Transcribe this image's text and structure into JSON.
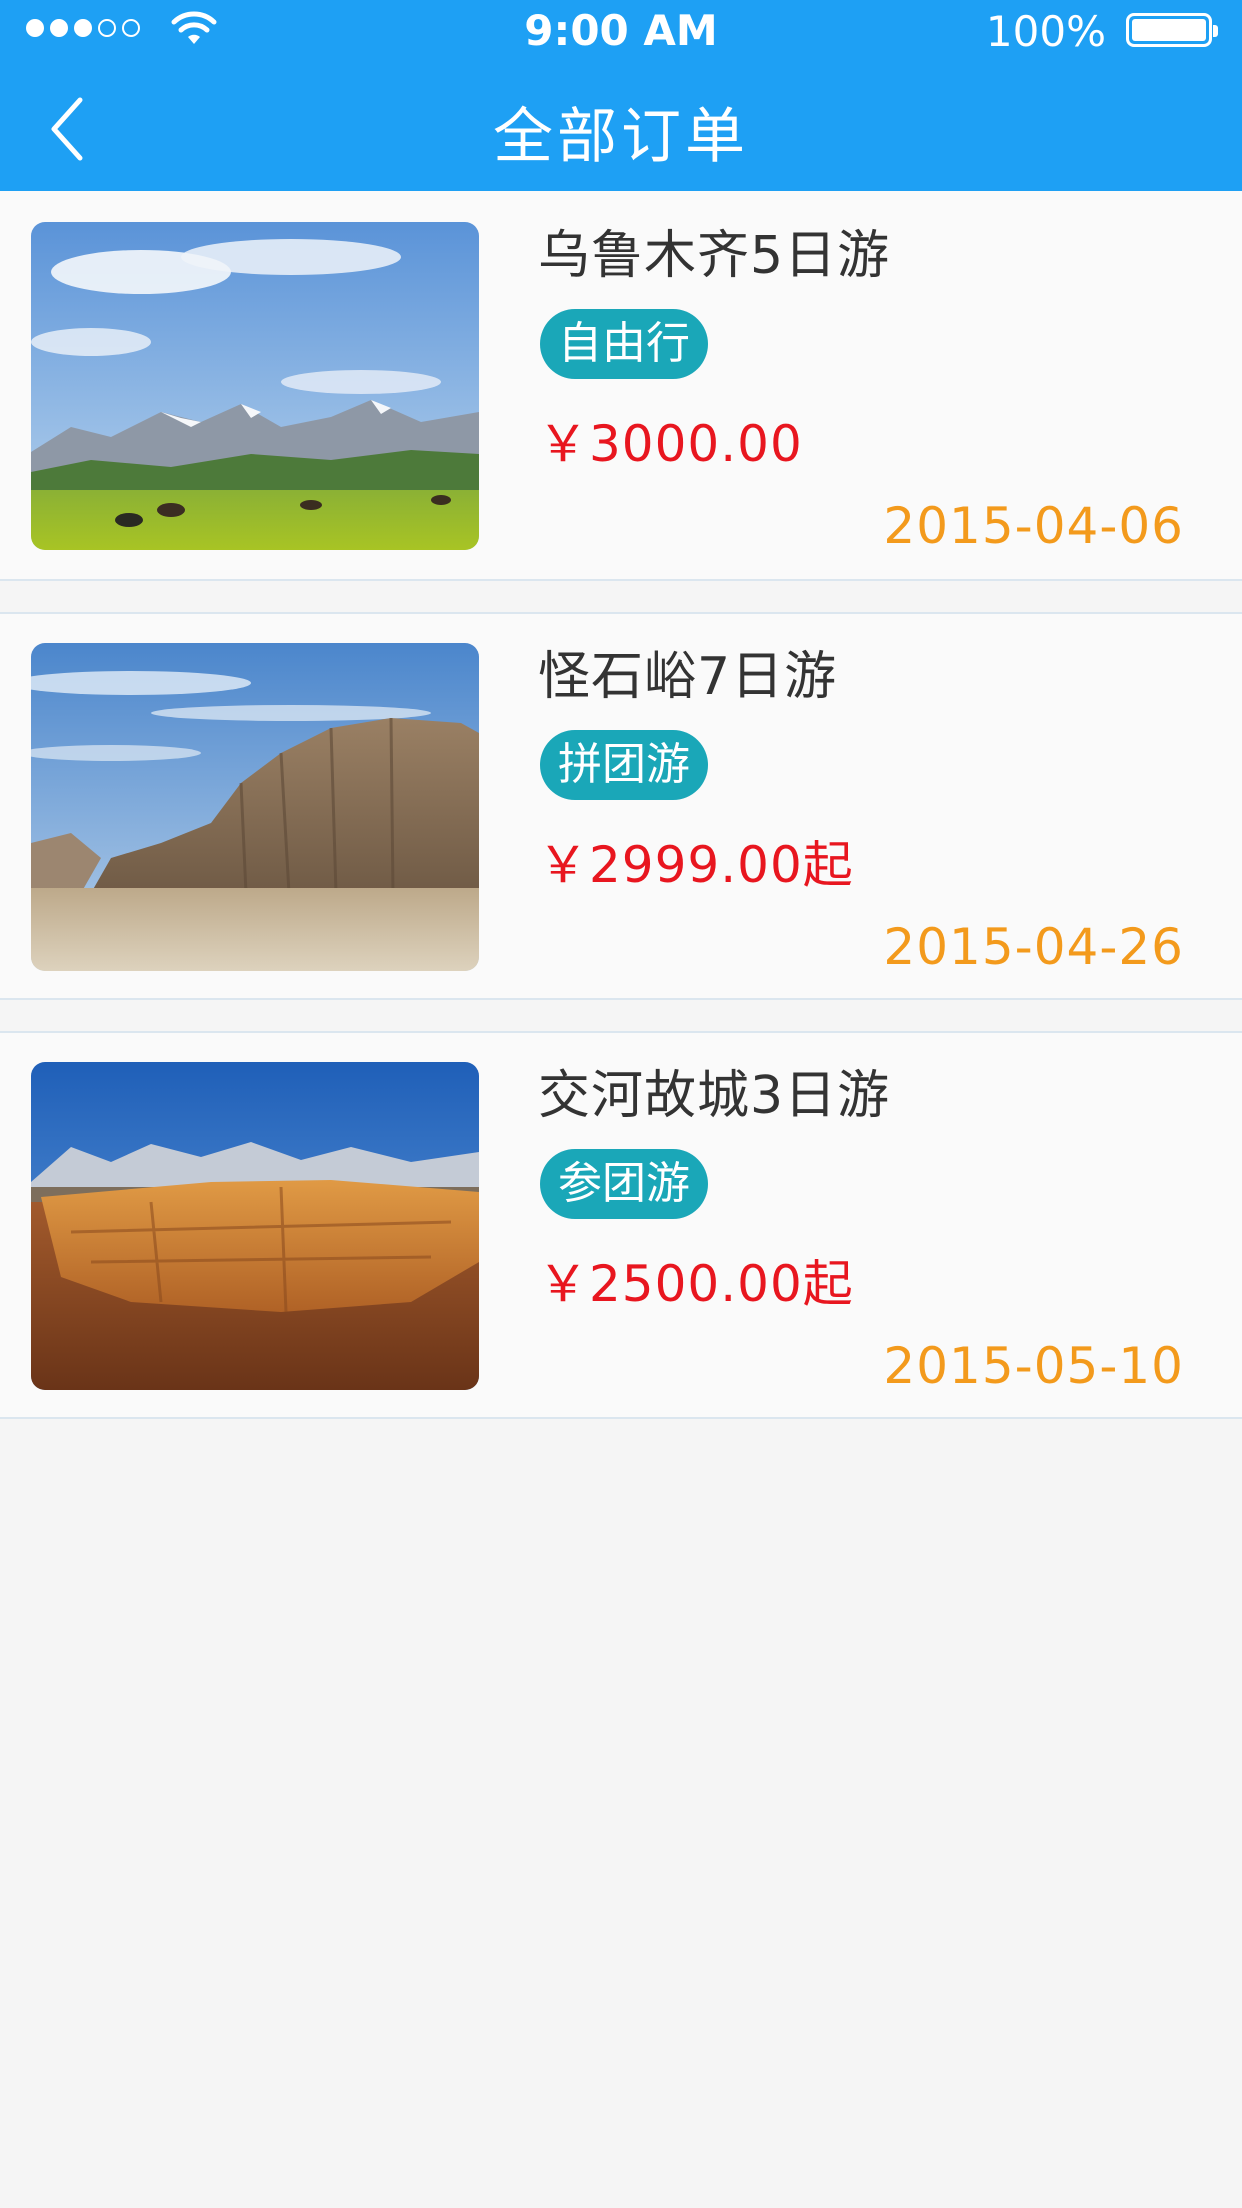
{
  "status_bar": {
    "time": "9:00 AM",
    "battery": "100%",
    "signal_dots_filled": 3,
    "signal_dots_total": 5
  },
  "nav": {
    "title": "全部订单",
    "back_icon": "chevron-left-icon"
  },
  "colors": {
    "header": "#1ea0f4",
    "tag": "#1aa7b8",
    "price": "#e8161f",
    "date": "#f39a1c"
  },
  "orders": [
    {
      "title": "乌鲁木齐5日游",
      "tag": "自由行",
      "price": "￥3000.00",
      "date": "2015-04-06",
      "image": "grassland-mountains-photo"
    },
    {
      "title": "怪石峪7日游",
      "tag": "拼团游",
      "price": "￥2999.00起",
      "date": "2015-04-26",
      "image": "desert-rock-formation-photo"
    },
    {
      "title": "交河故城3日游",
      "tag": "参团游",
      "price": "￥2500.00起",
      "date": "2015-05-10",
      "image": "ancient-city-ruins-photo"
    }
  ]
}
